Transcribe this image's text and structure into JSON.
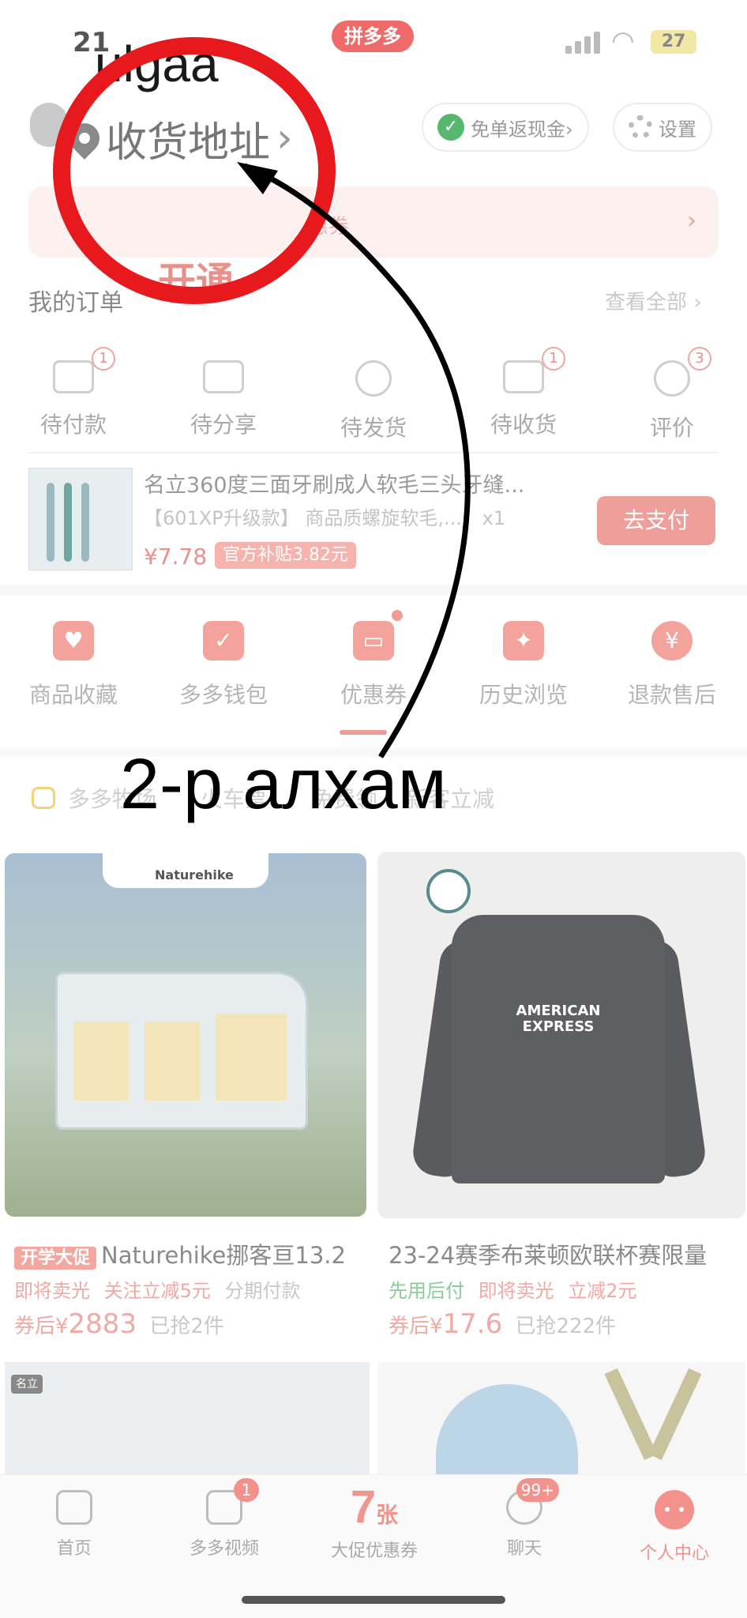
{
  "status_bar": {
    "time": "21",
    "app_badge": "拼多多",
    "battery": "27"
  },
  "header": {
    "username": "ulgaa",
    "address_label": "收货地址",
    "address_chevron": "›",
    "cashback_button": "免单返现金›",
    "settings_button": "设置"
  },
  "coupon_strip": {
    "text": "惠券",
    "chevron": "›",
    "open_text": "开通"
  },
  "orders": {
    "title": "我的订单",
    "view_all": "查看全部 ›",
    "statuses": [
      {
        "label": "待付款",
        "count": "1",
        "icon": "wallet-icon"
      },
      {
        "label": "待分享",
        "count": "",
        "icon": "share-icon"
      },
      {
        "label": "待发货",
        "count": "",
        "icon": "clock-icon"
      },
      {
        "label": "待收货",
        "count": "1",
        "icon": "truck-icon"
      },
      {
        "label": "评价",
        "count": "3",
        "icon": "review-icon"
      }
    ]
  },
  "pending_product": {
    "title": "名立360度三面牙刷成人软毛三头牙缝...",
    "spec": "【601XP升级款】 商品质螺旋软毛,...",
    "quantity": "x1",
    "price": "¥7.78",
    "subsidy": "官方补贴3.82元",
    "pay_button": "去支付"
  },
  "functions": [
    {
      "label": "商品收藏",
      "icon": "bag-icon",
      "glyph": "♥"
    },
    {
      "label": "多多钱包",
      "icon": "wallet-heart-icon",
      "glyph": "✓"
    },
    {
      "label": "优惠券",
      "icon": "coupon-icon",
      "glyph": "▭"
    },
    {
      "label": "历史浏览",
      "icon": "footprint-icon",
      "glyph": "✦"
    },
    {
      "label": "退款售后",
      "icon": "refund-icon",
      "glyph": "¥"
    }
  ],
  "banner": {
    "items": [
      "多多牧场",
      "火车票",
      "免费领",
      "新客立减"
    ]
  },
  "products": [
    {
      "brand": "Naturehike",
      "tag": "开学大促",
      "title": "Naturehike挪客亘13.2",
      "meta": [
        "即将卖光",
        "关注立减5元"
      ],
      "meta_gray": "分期付款",
      "price_prefix": "券后¥",
      "price": "2883",
      "sold": "已抢2件"
    },
    {
      "shirt_text": "AMERICAN EXPRESS",
      "title": "23-24赛季布莱顿欧联杯赛限量",
      "meta_green": "先用后付",
      "meta": [
        "即将卖光",
        "立减2元"
      ],
      "price_prefix": "券后¥",
      "price": "17.6",
      "sold": "已抢222件"
    }
  ],
  "next_products": {
    "brand_tag": "名立"
  },
  "tabbar": [
    {
      "label": "首页",
      "icon": "home-icon",
      "badge": ""
    },
    {
      "label": "多多视频",
      "icon": "video-icon",
      "badge": "1"
    },
    {
      "label": "大促优惠券",
      "big": "7",
      "unit": "张"
    },
    {
      "label": "聊天",
      "icon": "chat-icon",
      "badge": "99+"
    },
    {
      "label": "个人中心",
      "icon": "profile-icon",
      "badge": ""
    }
  ],
  "annotation": {
    "step_text": "2-р алхам",
    "circle_color": "#e8191c",
    "arrow_color": "#000000"
  },
  "colors": {
    "accent": "#f0948e",
    "annotation_red": "#e8191c"
  }
}
